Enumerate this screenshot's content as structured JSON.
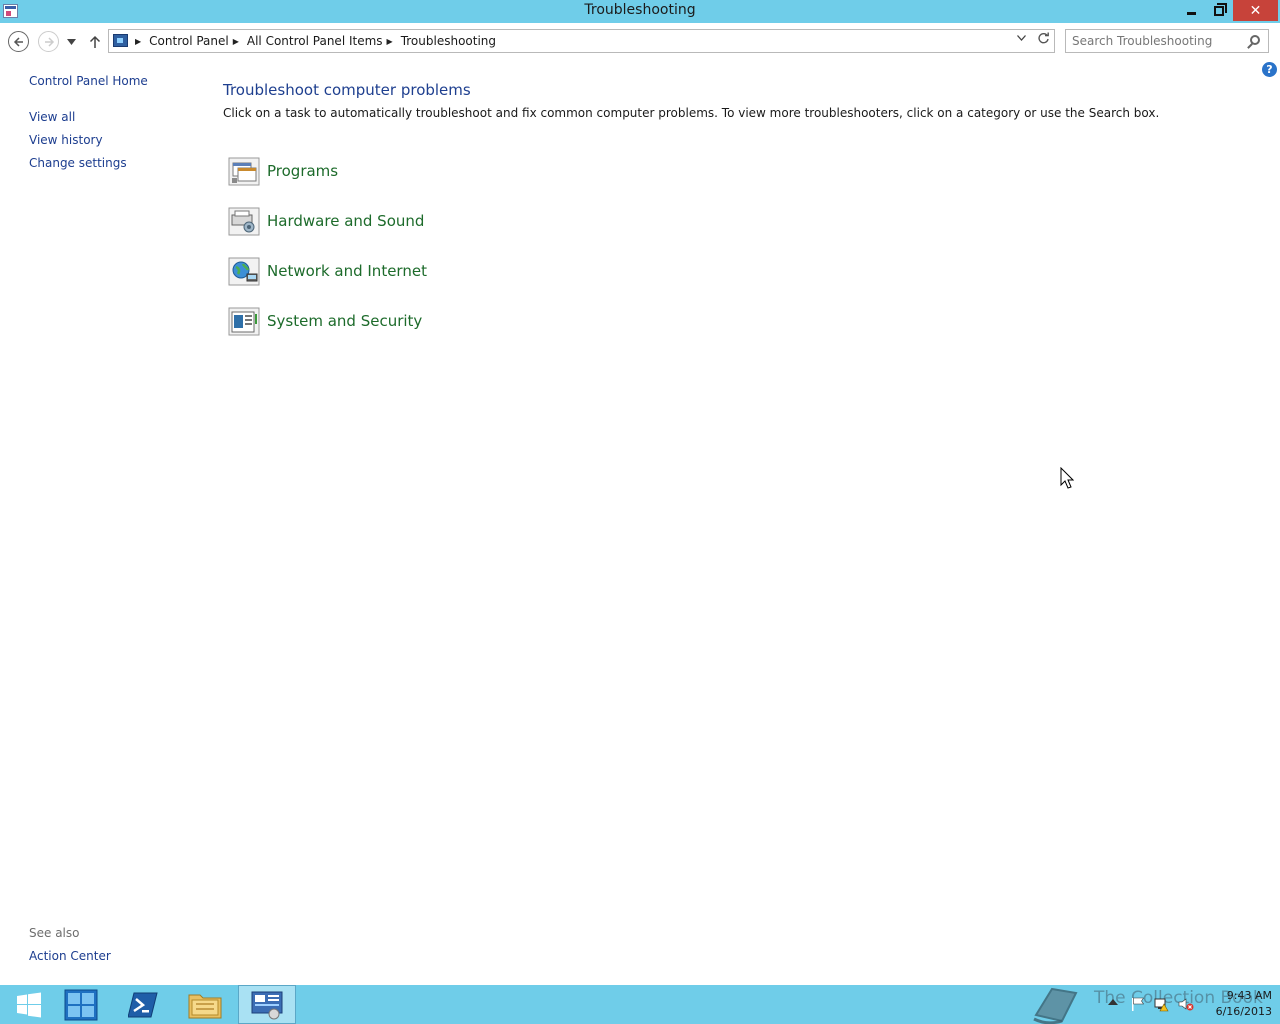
{
  "window": {
    "title": "Troubleshooting",
    "buttons": {
      "minimize": "minimize",
      "maximize": "maximize",
      "close": "✕"
    }
  },
  "navbar": {
    "breadcrumbs": [
      "Control Panel",
      "All Control Panel Items",
      "Troubleshooting"
    ],
    "search_placeholder": "Search Troubleshooting"
  },
  "sidebar": {
    "home": "Control Panel Home",
    "links": [
      "View all",
      "View history",
      "Change settings"
    ],
    "see_also_heading": "See also",
    "see_also_links": [
      "Action Center"
    ]
  },
  "main": {
    "heading": "Troubleshoot computer problems",
    "description": "Click on a task to automatically troubleshoot and fix common computer problems. To view more troubleshooters, click on a category or use the Search box.",
    "categories": [
      {
        "label": "Programs",
        "icon": "programs-icon"
      },
      {
        "label": "Hardware and Sound",
        "icon": "hardware-sound-icon"
      },
      {
        "label": "Network and Internet",
        "icon": "network-internet-icon"
      },
      {
        "label": "System and Security",
        "icon": "system-security-icon"
      }
    ]
  },
  "taskbar": {
    "items": [
      "start-icon",
      "server-manager-icon",
      "powershell-icon",
      "file-explorer-icon",
      "control-panel-icon"
    ],
    "watermark": "The Collection Book",
    "clock_time": "9:43 AM",
    "clock_date": "6/16/2013"
  },
  "colors": {
    "titlebar": "#6fcde9",
    "link": "#1c3d8f",
    "category_link": "#1d6b2b",
    "heading": "#1e3f8f"
  }
}
